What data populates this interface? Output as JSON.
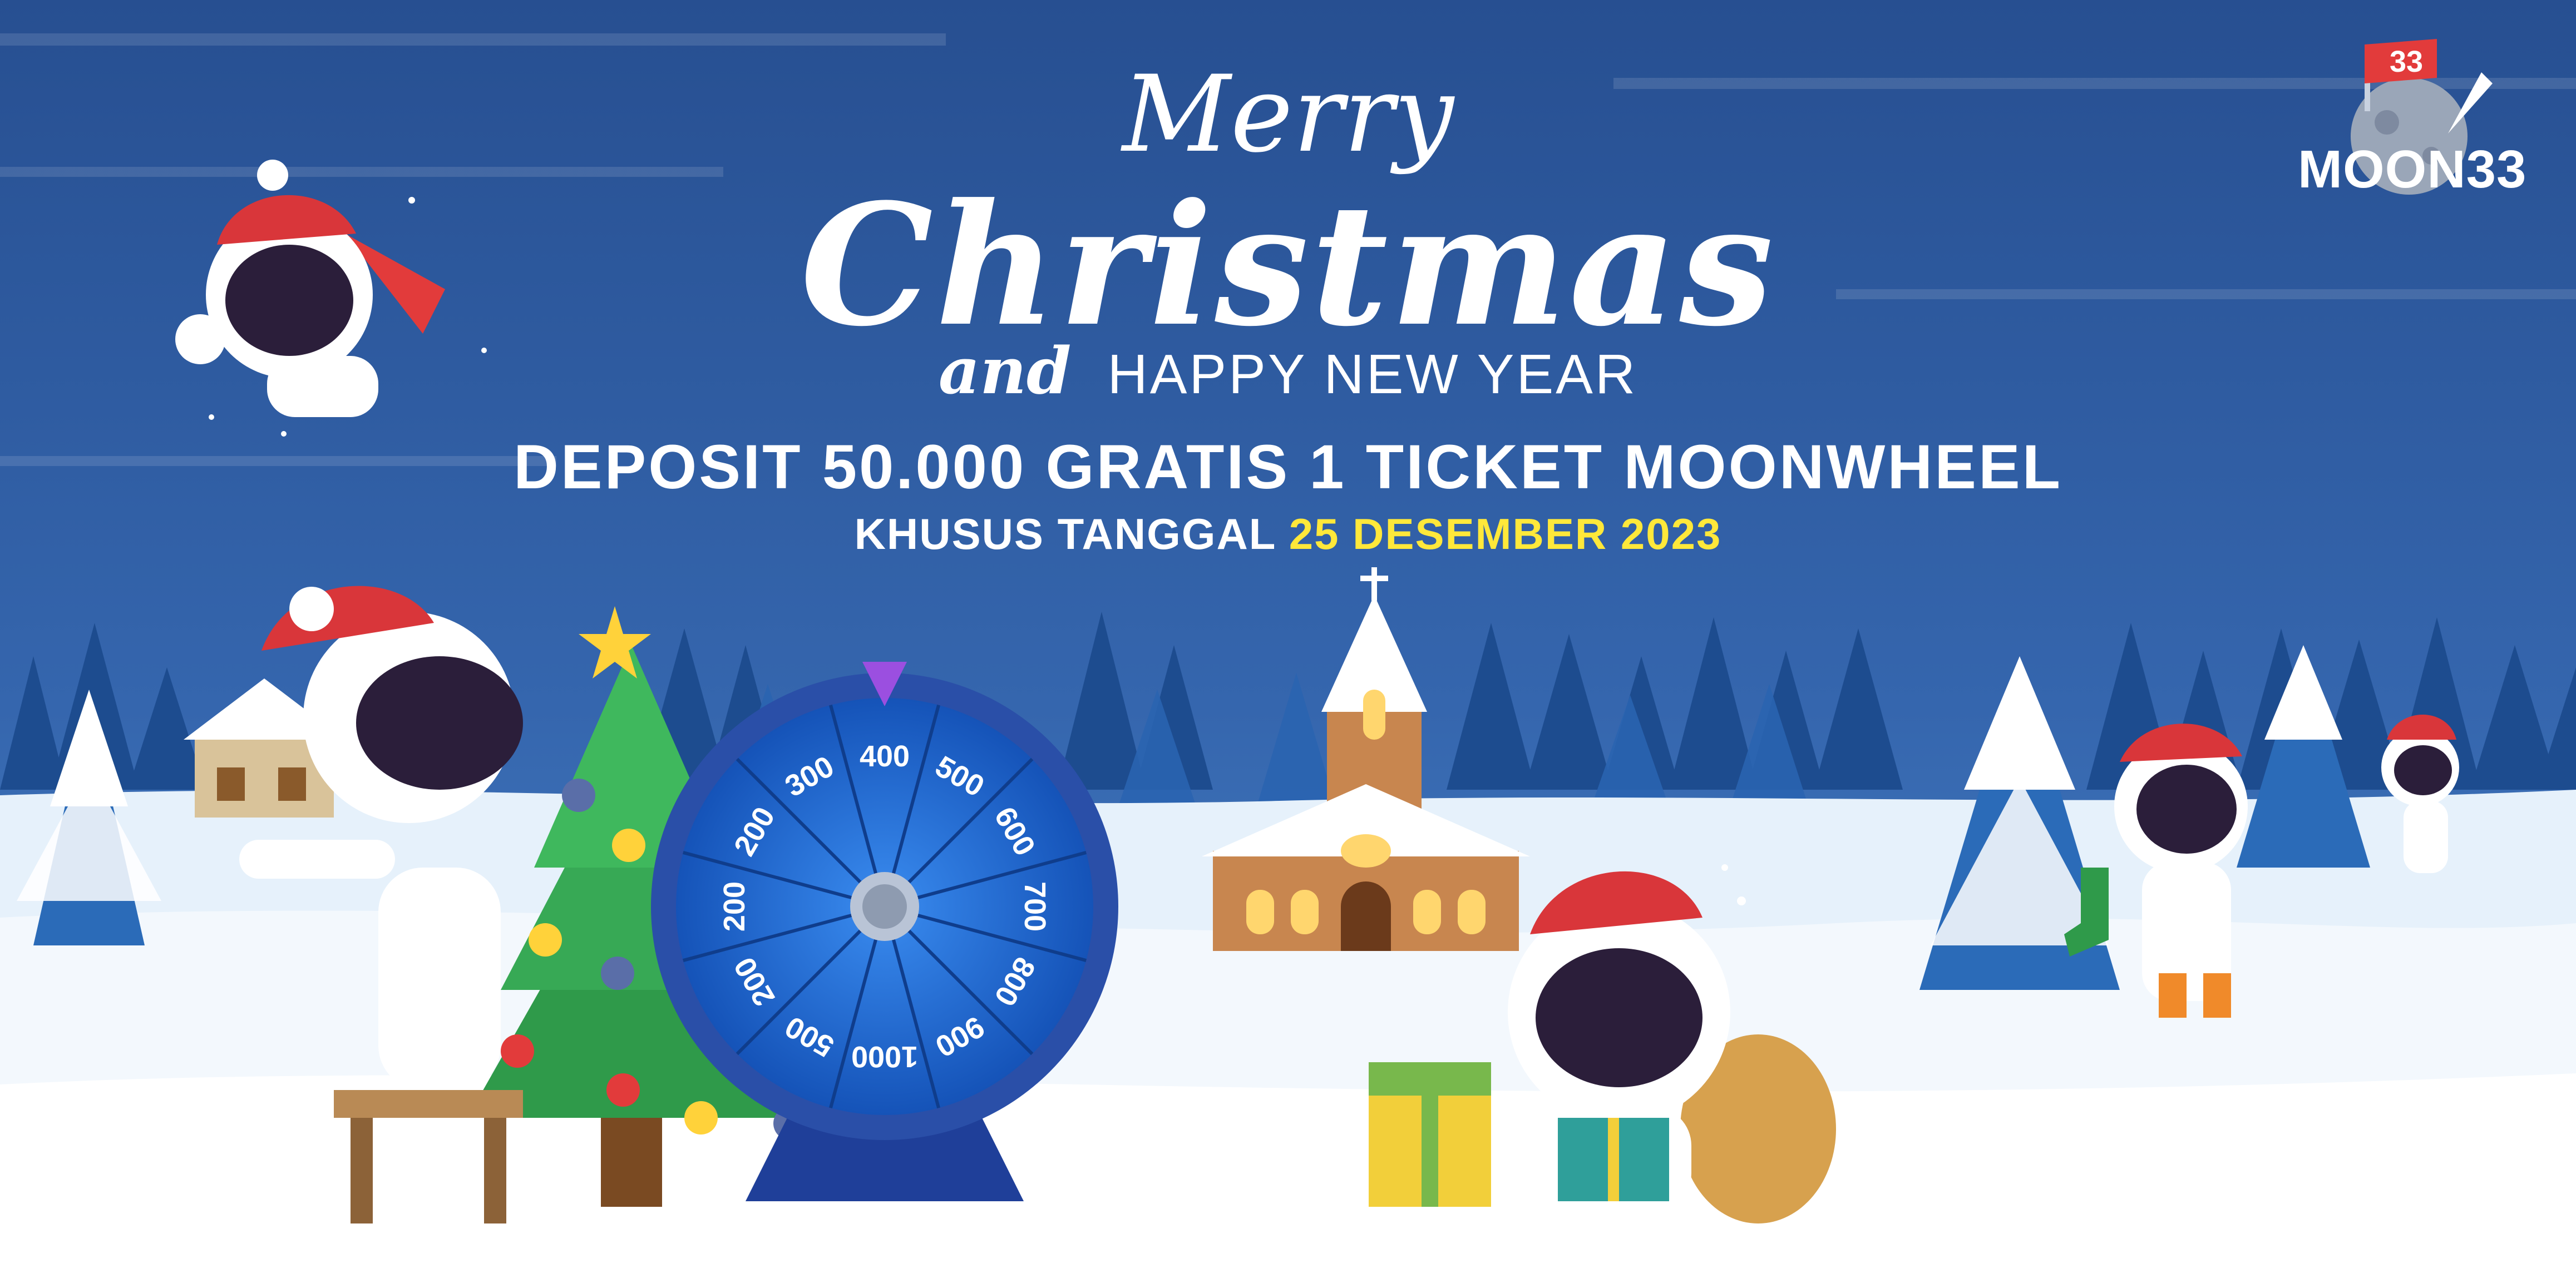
{
  "greeting": {
    "merry": "Merry",
    "christmas": "Christmas",
    "and": "and",
    "happy_new_year": "HAPPY NEW YEAR"
  },
  "promo": {
    "headline": "DEPOSIT 50.000 GRATIS 1 TICKET MOONWHEEL",
    "date_prefix": "KHUSUS TANGGAL",
    "date_highlight": "25 DESEMBER 2023"
  },
  "brand": {
    "logo_text": "MOON33",
    "logo_badge": "33"
  },
  "wheel": {
    "segments": [
      "400",
      "500",
      "600",
      "700",
      "800",
      "900",
      "1000",
      "500",
      "200",
      "200",
      "200",
      "300"
    ]
  },
  "colors": {
    "sky": "#2d5a9e",
    "snow": "#e6f1fb",
    "highlight": "#ffe83a",
    "wheel_blue": "#1e6fd6",
    "wheel_rim": "#2a4fa8"
  }
}
